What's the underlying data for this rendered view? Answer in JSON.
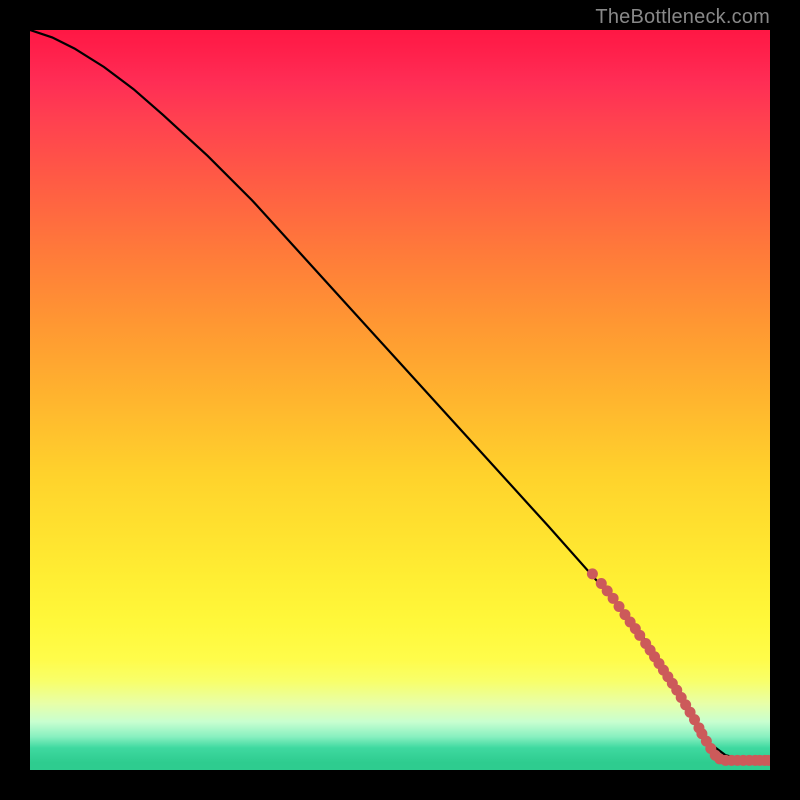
{
  "watermark": "TheBottleneck.com",
  "colors": {
    "curve": "#000000",
    "marker": "#cc5a5a",
    "background": "#000000"
  },
  "chart_data": {
    "type": "line",
    "title": "",
    "xlabel": "",
    "ylabel": "",
    "xlim": [
      0,
      100
    ],
    "ylim": [
      0,
      100
    ],
    "grid": false,
    "legend": false,
    "series": [
      {
        "name": "curve",
        "x": [
          0,
          3,
          6,
          10,
          14,
          18,
          24,
          30,
          40,
          50,
          60,
          70,
          78,
          84,
          88,
          90,
          92,
          94,
          96,
          98,
          100
        ],
        "y": [
          100,
          99,
          97.5,
          95,
          92,
          88.5,
          83,
          77,
          66,
          55,
          44,
          33,
          24,
          16.5,
          10,
          6,
          3.5,
          2,
          1.5,
          1.3,
          1.3
        ]
      }
    ],
    "markers": [
      {
        "x": 76,
        "y": 26.5
      },
      {
        "x": 77.2,
        "y": 25.2
      },
      {
        "x": 78.0,
        "y": 24.2
      },
      {
        "x": 78.8,
        "y": 23.2
      },
      {
        "x": 79.6,
        "y": 22.1
      },
      {
        "x": 80.4,
        "y": 21.0
      },
      {
        "x": 81.1,
        "y": 20.0
      },
      {
        "x": 81.8,
        "y": 19.1
      },
      {
        "x": 82.4,
        "y": 18.2
      },
      {
        "x": 83.2,
        "y": 17.1
      },
      {
        "x": 83.8,
        "y": 16.2
      },
      {
        "x": 84.4,
        "y": 15.3
      },
      {
        "x": 85.0,
        "y": 14.4
      },
      {
        "x": 85.6,
        "y": 13.5
      },
      {
        "x": 86.2,
        "y": 12.6
      },
      {
        "x": 86.8,
        "y": 11.7
      },
      {
        "x": 87.4,
        "y": 10.8
      },
      {
        "x": 88.0,
        "y": 9.8
      },
      {
        "x": 88.6,
        "y": 8.8
      },
      {
        "x": 89.2,
        "y": 7.8
      },
      {
        "x": 89.8,
        "y": 6.8
      },
      {
        "x": 90.4,
        "y": 5.7
      },
      {
        "x": 90.8,
        "y": 4.9
      },
      {
        "x": 91.4,
        "y": 3.9
      },
      {
        "x": 92.0,
        "y": 2.9
      },
      {
        "x": 92.6,
        "y": 2.0
      },
      {
        "x": 93.2,
        "y": 1.5
      },
      {
        "x": 94.0,
        "y": 1.3
      },
      {
        "x": 94.8,
        "y": 1.3
      },
      {
        "x": 95.6,
        "y": 1.3
      },
      {
        "x": 96.4,
        "y": 1.3
      },
      {
        "x": 97.2,
        "y": 1.3
      },
      {
        "x": 98.0,
        "y": 1.3
      },
      {
        "x": 98.6,
        "y": 1.3
      },
      {
        "x": 99.3,
        "y": 1.3
      },
      {
        "x": 99.8,
        "y": 1.3
      }
    ]
  }
}
